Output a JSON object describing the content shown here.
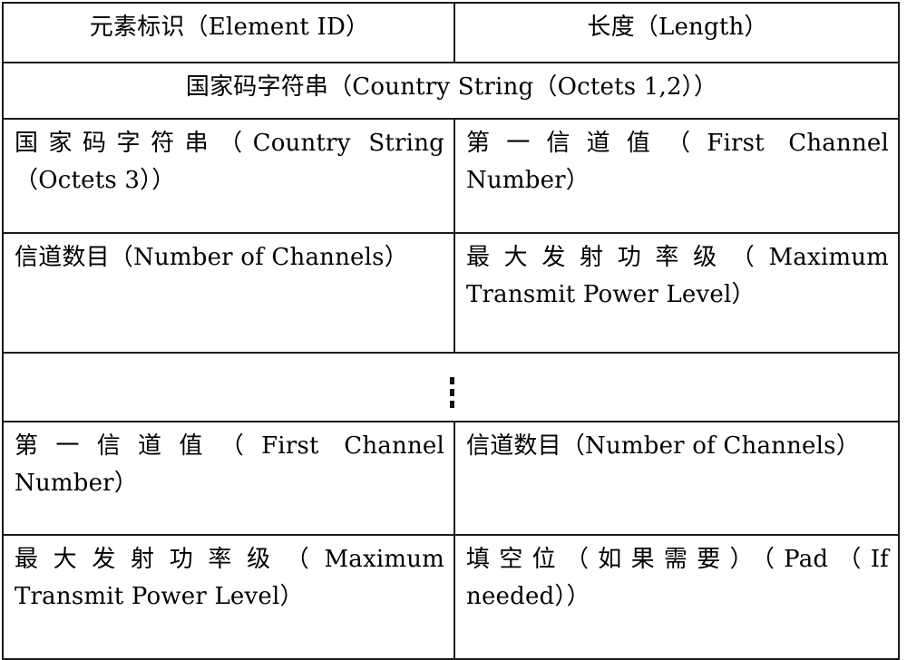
{
  "document": {
    "title": "Country Information Element Frame Format",
    "type": "table"
  },
  "table": {
    "columns": [
      "left",
      "right"
    ],
    "rows": [
      {
        "id": "row-element-id-length",
        "layout": "two-column",
        "left": {
          "text": "元素标识（Element ID）",
          "align": "center"
        },
        "right": {
          "text": "长度（Length）",
          "align": "center"
        }
      },
      {
        "id": "row-country-string-octets-1-2",
        "layout": "full-width",
        "full": {
          "text": "国家码字符串（Country String（Octets 1,2））",
          "align": "center"
        }
      },
      {
        "id": "row-country-string-octet-3",
        "layout": "two-column",
        "left": {
          "line1": "国家码字符串（Country String",
          "line2": "（Octets 3））"
        },
        "right": {
          "line1": "第一信道值（First Channel",
          "line2": "Number）"
        }
      },
      {
        "id": "row-number-of-channels-max-power",
        "layout": "two-column",
        "left": {
          "line1": "信道数目（Number of Channels）",
          "line2": ""
        },
        "right": {
          "line1": "最大发射功率级（Maximum",
          "line2": "Transmit Power Level）"
        }
      },
      {
        "id": "row-continuation-ellipsis",
        "layout": "full-width-ellipsis",
        "full": {
          "glyph": "vertical-ellipsis",
          "dots": 3
        }
      },
      {
        "id": "row-first-channel-number-of-channels",
        "layout": "two-column",
        "left": {
          "line1": "第一信道值（First Channel",
          "line2": "Number）"
        },
        "right": {
          "line1": "信道数目（Number of Channels）",
          "line2": ""
        }
      },
      {
        "id": "row-max-power-pad",
        "layout": "two-column",
        "left": {
          "line1": "最大发射功率级（Maximum",
          "line2": "Transmit Power Level）"
        },
        "right": {
          "line1": "填空位（如果需要）（Pad（If",
          "line2": "needed））"
        }
      }
    ]
  },
  "style": {
    "border_color": "#1a1a1a",
    "text_color": "#000000",
    "background": "#ffffff"
  }
}
